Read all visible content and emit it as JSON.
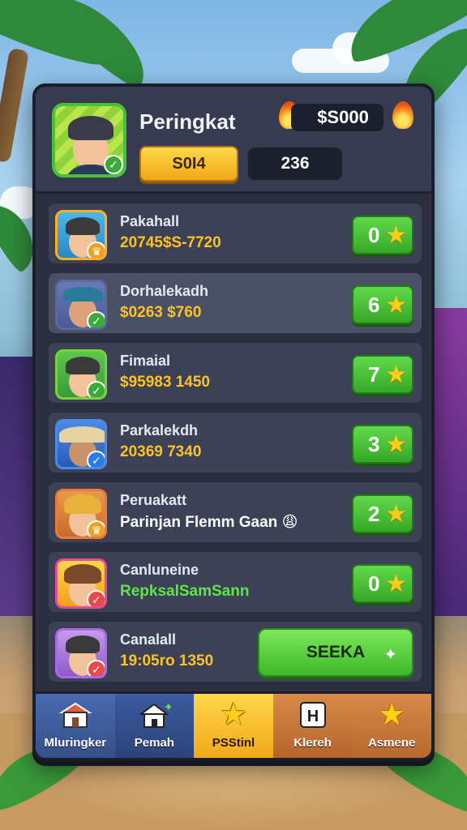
{
  "header": {
    "title": "Peringkat",
    "coins": "$S000",
    "button_label": "S0I4",
    "score": "236"
  },
  "rows": [
    {
      "name": "Pakahall",
      "score": "20745$S-7720",
      "rank": "0",
      "score_color": "gold",
      "badge": "crown"
    },
    {
      "name": "Dorhalekadh",
      "score": "$0263 $760",
      "rank": "6",
      "score_color": "gold",
      "badge": "check"
    },
    {
      "name": "Fimaial",
      "score": "$95983 1450",
      "rank": "7",
      "score_color": "gold",
      "badge": "check"
    },
    {
      "name": "Parkalekdh",
      "score": "20369 7340",
      "rank": "3",
      "score_color": "gold",
      "badge": "check-blue"
    },
    {
      "name": "Peruakatt",
      "score": "Parinjan Flemm Gaan 😩",
      "rank": "2",
      "score_color": "white",
      "badge": "crown"
    },
    {
      "name": "Canluneine",
      "score": "RepksalSamSann",
      "rank": "0",
      "score_color": "green",
      "badge": "check-red"
    },
    {
      "name": "Canalall",
      "score": "19:05ro 1350",
      "action": "SEEKA",
      "score_color": "gold",
      "badge": "check-red"
    }
  ],
  "tabs": [
    {
      "label": "Mluringker",
      "icon": "shop-icon"
    },
    {
      "label": "Pemah",
      "icon": "home-icon"
    },
    {
      "label": "PSStinl",
      "icon": "star-icon"
    },
    {
      "label": "Klereh",
      "icon": "h-box-icon"
    },
    {
      "label": "Asmene",
      "icon": "star-icon"
    }
  ],
  "colors": {
    "panel": "#2b2f40",
    "rank_button": "#46c23a",
    "gold": "#ffc21f",
    "tab_active": "#f2a91a"
  }
}
